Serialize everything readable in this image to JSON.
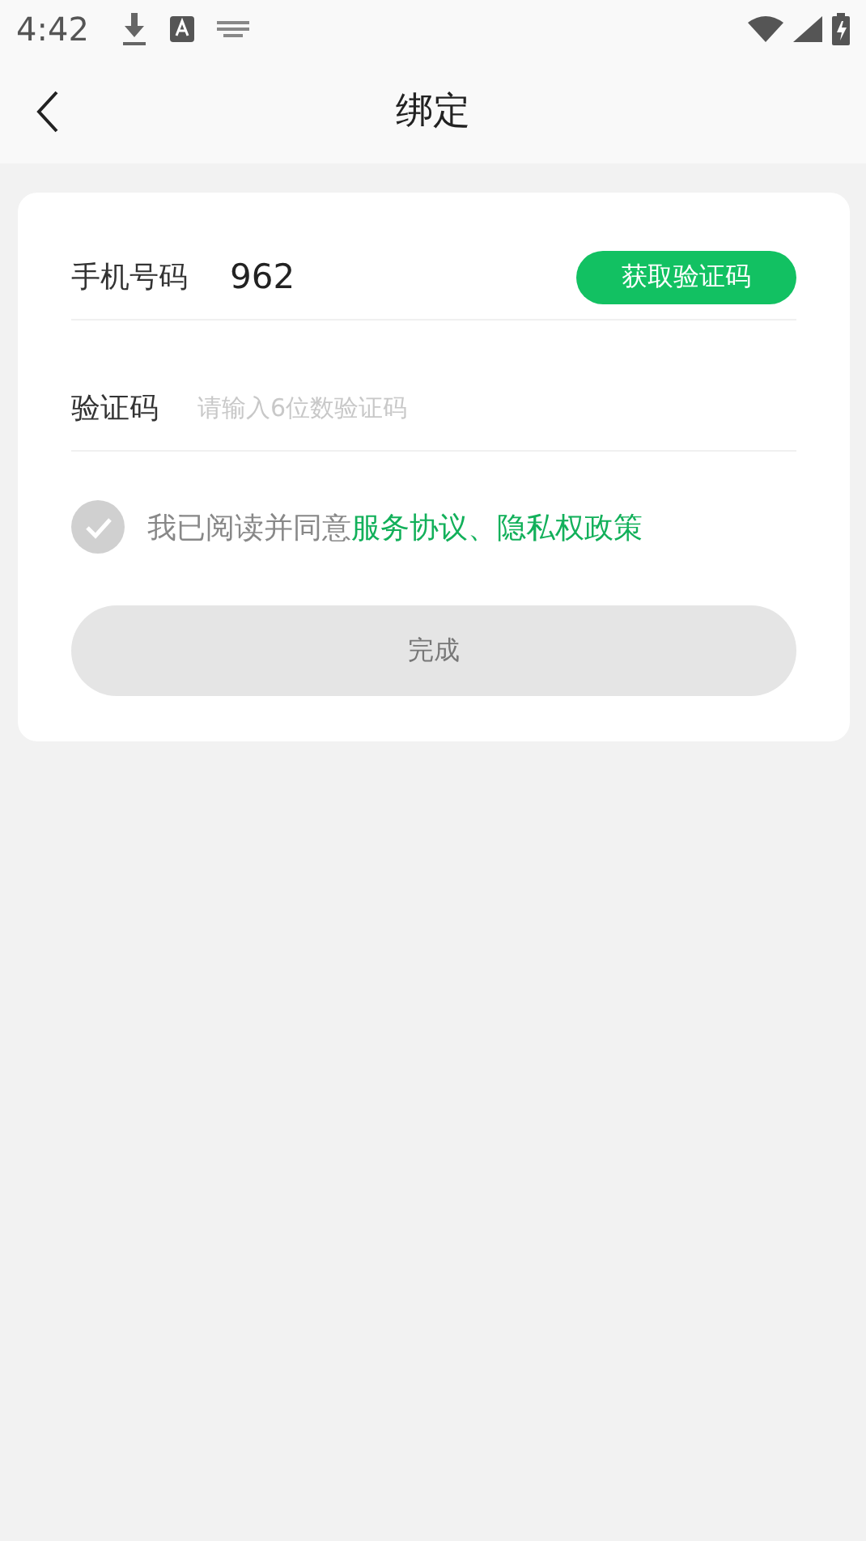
{
  "status_bar": {
    "time": "4:42"
  },
  "header": {
    "title": "绑定"
  },
  "form": {
    "phone": {
      "label": "手机号码",
      "value": "962",
      "button": "获取验证码"
    },
    "code": {
      "label": "验证码",
      "placeholder": "请输入6位数验证码"
    },
    "agreement": {
      "checked": false,
      "text": "我已阅读并同意",
      "links": [
        "服务协议",
        "隐私权政策"
      ],
      "separator": "、"
    },
    "submit": {
      "label": "完成",
      "disabled": true
    }
  }
}
